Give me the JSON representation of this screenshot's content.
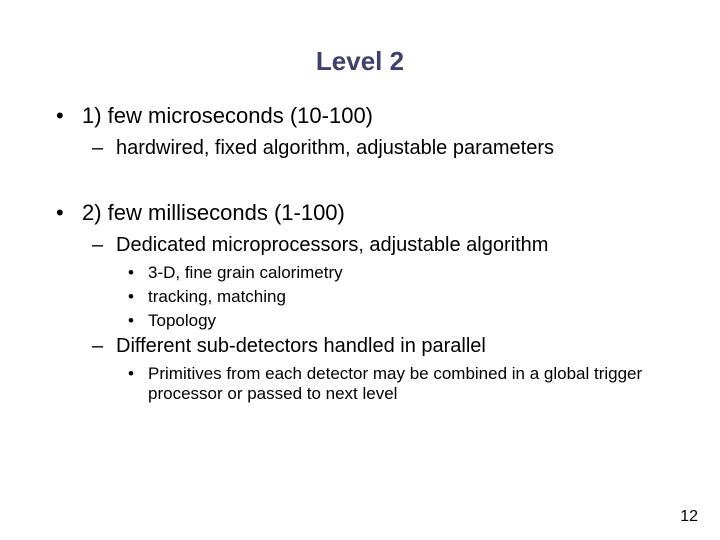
{
  "title": "Level 2",
  "items": [
    {
      "label": "1) few microseconds (10-100)",
      "sub": [
        {
          "label": "hardwired, fixed algorithm, adjustable parameters",
          "sub": []
        }
      ]
    },
    {
      "label": "2) few milliseconds (1-100)",
      "sub": [
        {
          "label": "Dedicated microprocessors, adjustable algorithm",
          "sub": [
            {
              "label": "3-D, fine grain calorimetry"
            },
            {
              "label": "tracking, matching"
            },
            {
              "label": "Topology"
            }
          ]
        },
        {
          "label": "Different sub-detectors handled in parallel",
          "sub": [
            {
              "label": "Primitives from each detector may be combined in a global trigger processor or passed to next level"
            }
          ]
        }
      ]
    }
  ],
  "bullets": {
    "l1": "•",
    "l2": "–",
    "l3": "•"
  },
  "page_number": "12"
}
